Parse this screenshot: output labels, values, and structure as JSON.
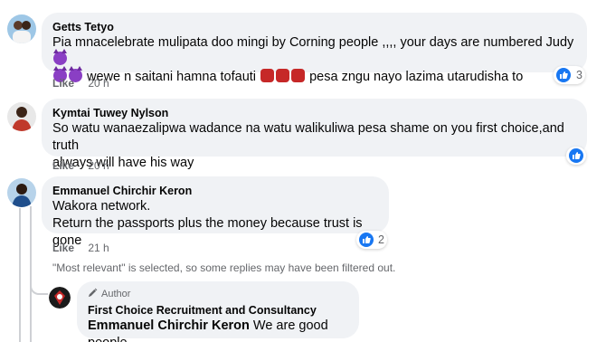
{
  "comments": [
    {
      "author": "Getts Tetyo",
      "line1": "Pia mnacelebrate mulipata doo mingi by Corning people ,,,, your days are numbered Judy",
      "line2_a": "wewe n saitani hamna tofauti",
      "line2_b": "pesa zngu nayo lazima utarudisha to",
      "like_label": "Like",
      "time": "20 h",
      "reaction_count": "3"
    },
    {
      "author": "Kymtai Tuwey Nylson",
      "line1": "So watu wanaezalipwa wadance na watu walikuliwa pesa shame on you first choice,and truth",
      "line2": "always will have his way",
      "like_label": "Like",
      "time": "20 h"
    },
    {
      "author": "Emmanuel Chirchir Keron",
      "line1": "Wakora network.",
      "line2": "Return the passports plus the money because trust is gone",
      "like_label": "Like",
      "time": "21 h",
      "reaction_count": "2"
    }
  ],
  "filter_notice": "\"Most relevant\" is selected, so some replies may have been filtered out.",
  "reply": {
    "badge": "Author",
    "author": "First Choice Recruitment and Consultancy",
    "mention": "Emmanuel Chirchir Keron",
    "text": "We are good people"
  },
  "colors": {
    "like_blue": "#1877f2",
    "bubble": "#f0f2f5",
    "secondary_text": "#65676b"
  }
}
